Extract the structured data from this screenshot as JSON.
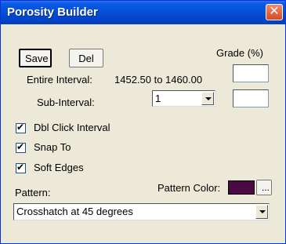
{
  "window": {
    "title": "Porosity Builder",
    "close_glyph": "✕"
  },
  "buttons": {
    "save": "Save",
    "delete": "Del",
    "browse": "..."
  },
  "grade": {
    "label": "Grade (%)",
    "value": ""
  },
  "entire_interval": {
    "label": "Entire Interval:",
    "value": "1452.50 to 1460.00"
  },
  "sub_interval": {
    "label": "Sub-Interval:",
    "selected": "1",
    "grade_value": ""
  },
  "checkboxes": [
    {
      "label": "Dbl Click Interval",
      "checked": true
    },
    {
      "label": "Snap To",
      "checked": true
    },
    {
      "label": "Soft Edges",
      "checked": true
    }
  ],
  "pattern": {
    "label": "Pattern:",
    "selected": "Crosshatch at 45 degrees"
  },
  "pattern_color": {
    "label": "Pattern Color:",
    "color": "#4a0a44"
  }
}
